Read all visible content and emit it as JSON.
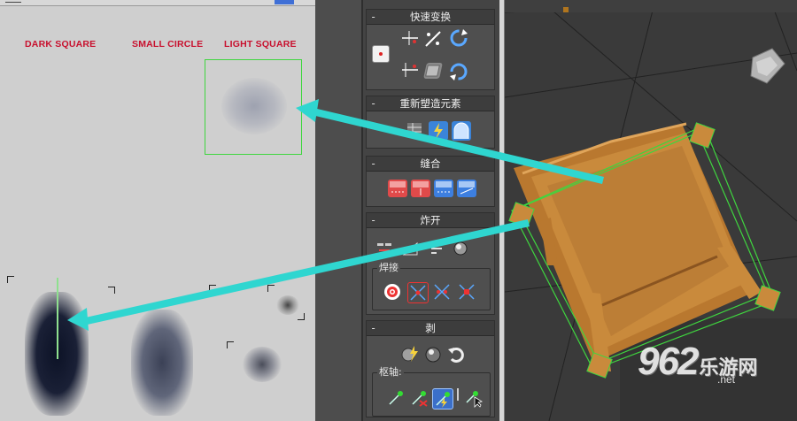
{
  "uv_editor": {
    "texture_labels": [
      "DARK SQUARE",
      "SMALL CIRCLE",
      "LIGHT SQUARE"
    ]
  },
  "panel": {
    "rollouts": [
      {
        "title": "快速变换"
      },
      {
        "title": "重新塑造元素"
      },
      {
        "title": "缝合"
      },
      {
        "title": "炸开",
        "sub_label": "焊接"
      },
      {
        "title": "剥",
        "sub_label": "枢轴:"
      }
    ],
    "collapse_symbol": "-"
  },
  "viewport": {
    "watermark_number": "962",
    "watermark_text": "乐游网",
    "watermark_domain": ".net"
  },
  "colors": {
    "texture_label": "#c8102e",
    "selection_green": "#3fd63f",
    "arrow_cyan": "#2fd6d0",
    "chair_wood": "#c98a3c"
  }
}
